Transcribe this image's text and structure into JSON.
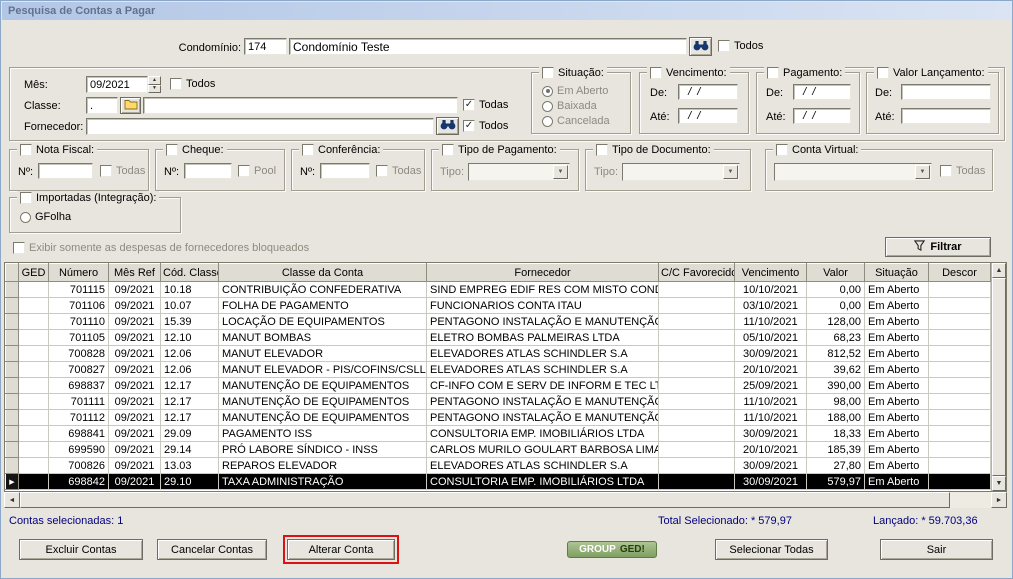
{
  "window": {
    "title": "Pesquisa de Contas a Pagar"
  },
  "header": {
    "condominio_label": "Condomínio:",
    "condominio_code": "174",
    "condominio_name": "Condomínio Teste",
    "todos_label": "Todos",
    "todos_checked": false
  },
  "filters": {
    "mes": {
      "label": "Mês:",
      "value": "09/2021",
      "todos_label": "Todos",
      "todos_checked": false
    },
    "classe": {
      "label": "Classe:",
      "code": ".",
      "name": "",
      "todas_label": "Todas",
      "todas_checked": true
    },
    "fornecedor": {
      "label": "Fornecedor:",
      "name": "",
      "todos_label": "Todos",
      "todos_checked": true
    },
    "situacao": {
      "title": "Situação:",
      "checked": false,
      "options": [
        {
          "label": "Em Aberto",
          "selected": true
        },
        {
          "label": "Baixada",
          "selected": false
        },
        {
          "label": "Cancelada",
          "selected": false
        }
      ]
    },
    "vencimento": {
      "title": "Vencimento:",
      "checked": false,
      "de_label": "De:",
      "de_value": "  /  /",
      "ate_label": "Até:",
      "ate_value": "  /  /"
    },
    "pagamento": {
      "title": "Pagamento:",
      "checked": false,
      "de_label": "De:",
      "de_value": "  /  /",
      "ate_label": "Até:",
      "ate_value": "  /  /"
    },
    "valor_lancamento": {
      "title": "Valor Lançamento:",
      "checked": false,
      "de_label": "De:",
      "de_value": "",
      "ate_label": "Até:",
      "ate_value": ""
    },
    "nota_fiscal": {
      "title": "Nota Fiscal:",
      "checked": false,
      "numero_label": "Nº:",
      "numero_value": "",
      "todas_label": "Todas",
      "todas_checked": false
    },
    "cheque": {
      "title": "Cheque:",
      "checked": false,
      "numero_label": "Nº:",
      "numero_value": "",
      "pool_label": "Pool",
      "pool_checked": false
    },
    "conferencia": {
      "title": "Conferência:",
      "checked": false,
      "numero_label": "Nº:",
      "numero_value": "",
      "todas_label": "Todas",
      "todas_checked": false
    },
    "tipo_pagamento": {
      "title": "Tipo de Pagamento:",
      "checked": false,
      "tipo_label": "Tipo:",
      "value": ""
    },
    "tipo_documento": {
      "title": "Tipo de Documento:",
      "checked": false,
      "tipo_label": "Tipo:",
      "value": ""
    },
    "conta_virtual": {
      "title": "Conta Virtual:",
      "checked": false,
      "value": "",
      "todas_label": "Todas",
      "todas_checked": false
    },
    "importadas": {
      "title": "Importadas (Integração):",
      "checked": false,
      "gfolha_label": "GFolha",
      "gfolha_selected": false
    },
    "exibir_bloqueados_label": "Exibir somente as despesas de fornecedores bloqueados",
    "exibir_bloqueados_checked": false,
    "filtrar_label": "Filtrar"
  },
  "grid": {
    "columns": [
      "GED",
      "Número",
      "Mês Ref",
      "Cód. Classe",
      "Classe da Conta",
      "Fornecedor",
      "C/C Favorecido",
      "Vencimento",
      "Valor",
      "Situação",
      "Descor"
    ],
    "rows": [
      [
        "",
        "701115",
        "09/2021",
        "10.18",
        "CONTRIBUIÇÃO CONFEDERATIVA",
        "SIND EMPREG EDIF RES COM MISTO COND RJ",
        "",
        "10/10/2021",
        "0,00",
        "Em Aberto",
        ""
      ],
      [
        "",
        "701106",
        "09/2021",
        "10.07",
        "FOLHA DE PAGAMENTO",
        "FUNCIONARIOS CONTA ITAU",
        "",
        "03/10/2021",
        "0,00",
        "Em Aberto",
        ""
      ],
      [
        "",
        "701110",
        "09/2021",
        "15.39",
        "LOCAÇÃO DE EQUIPAMENTOS",
        "PENTAGONO INSTALAÇÃO E MANUTENÇÃO LTDA",
        "",
        "11/10/2021",
        "128,00",
        "Em Aberto",
        ""
      ],
      [
        "",
        "701105",
        "09/2021",
        "12.10",
        "MANUT BOMBAS",
        "ELETRO BOMBAS PALMEIRAS LTDA",
        "",
        "05/10/2021",
        "68,23",
        "Em Aberto",
        ""
      ],
      [
        "",
        "700828",
        "09/2021",
        "12.06",
        "MANUT ELEVADOR",
        "ELEVADORES ATLAS SCHINDLER S.A",
        "",
        "30/09/2021",
        "812,52",
        "Em Aberto",
        ""
      ],
      [
        "",
        "700827",
        "09/2021",
        "12.06",
        "MANUT ELEVADOR - PIS/COFINS/CSLL",
        "ELEVADORES ATLAS SCHINDLER S.A",
        "",
        "20/10/2021",
        "39,62",
        "Em Aberto",
        ""
      ],
      [
        "",
        "698837",
        "09/2021",
        "12.17",
        "MANUTENÇÃO DE EQUIPAMENTOS",
        "CF-INFO COM E SERV DE INFORM E TEC LTDA",
        "",
        "25/09/2021",
        "390,00",
        "Em Aberto",
        ""
      ],
      [
        "",
        "701111",
        "09/2021",
        "12.17",
        "MANUTENÇÃO DE EQUIPAMENTOS",
        "PENTAGONO INSTALAÇÃO E MANUTENÇÃO LTDA",
        "",
        "11/10/2021",
        "98,00",
        "Em Aberto",
        ""
      ],
      [
        "",
        "701112",
        "09/2021",
        "12.17",
        "MANUTENÇÃO DE EQUIPAMENTOS",
        "PENTAGONO INSTALAÇÃO E MANUTENÇÃO LTDA",
        "",
        "11/10/2021",
        "188,00",
        "Em Aberto",
        ""
      ],
      [
        "",
        "698841",
        "09/2021",
        "29.09",
        "PAGAMENTO ISS",
        "CONSULTORIA EMP. IMOBILIÁRIOS LTDA",
        "",
        "30/09/2021",
        "18,33",
        "Em Aberto",
        ""
      ],
      [
        "",
        "699590",
        "09/2021",
        "29.14",
        "PRÓ LABORE SÍNDICO - INSS",
        "CARLOS MURILO GOULART BARBOSA LIMA",
        "",
        "20/10/2021",
        "185,39",
        "Em Aberto",
        ""
      ],
      [
        "",
        "700826",
        "09/2021",
        "13.03",
        "REPAROS ELEVADOR",
        "ELEVADORES ATLAS SCHINDLER S.A",
        "",
        "30/09/2021",
        "27,80",
        "Em Aberto",
        ""
      ],
      [
        "",
        "698842",
        "09/2021",
        "29.10",
        "TAXA ADMINISTRAÇÃO",
        "CONSULTORIA EMP. IMOBILIÁRIOS LTDA",
        "",
        "30/09/2021",
        "579,97",
        "Em Aberto",
        ""
      ]
    ],
    "selected_row_index": 12
  },
  "footer": {
    "contas_selecionadas": "Contas selecionadas: 1",
    "total_selecionado": "Total Selecionado: * 579,97",
    "lancado": "Lançado: * 59.703,36"
  },
  "actions": {
    "excluir": "Excluir Contas",
    "cancelar": "Cancelar Contas",
    "alterar": "Alterar Conta",
    "group_ged_part1": "GROUP",
    "group_ged_part2": "GED!",
    "selecionar_todas": "Selecionar Todas",
    "sair": "Sair"
  },
  "colors": {
    "highlight_border": "#dd1111",
    "selection_bg": "#000000",
    "footer_text": "#00007f",
    "ged_button_green": "#7e9f61",
    "titlebar_blue": "#b2c6e6"
  }
}
